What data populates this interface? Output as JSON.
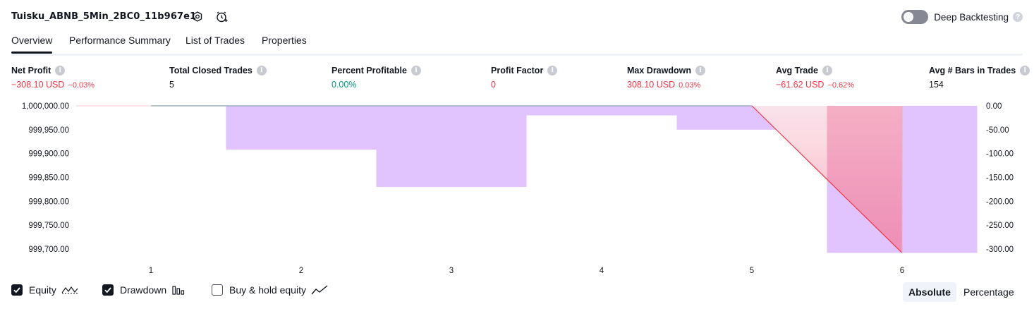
{
  "header": {
    "strategy_title": "Tuisku_ABNB_5Min_2BC0_11b967e1",
    "settings_icon": "gear-icon",
    "alert_icon": "alarm-clock-plus-icon",
    "deep_backtesting_label": "Deep Backtesting",
    "deep_backtesting_enabled": false,
    "help_glyph": "?"
  },
  "tabs": [
    {
      "label": "Overview",
      "active": true
    },
    {
      "label": "Performance Summary",
      "active": false
    },
    {
      "label": "List of Trades",
      "active": false
    },
    {
      "label": "Properties",
      "active": false
    }
  ],
  "metrics": [
    {
      "label": "Net Profit",
      "value": "−308.10 USD",
      "sub": "−0.03%",
      "tone": "neg"
    },
    {
      "label": "Total Closed Trades",
      "value": "5",
      "sub": "",
      "tone": "neutral"
    },
    {
      "label": "Percent Profitable",
      "value": "0.00%",
      "sub": "",
      "tone": "pos"
    },
    {
      "label": "Profit Factor",
      "value": "0",
      "sub": "",
      "tone": "neg"
    },
    {
      "label": "Max Drawdown",
      "value": "308.10 USD",
      "sub": "0.03%",
      "tone": "neg"
    },
    {
      "label": "Avg Trade",
      "value": "−61.62 USD",
      "sub": "−0.62%",
      "tone": "neg"
    },
    {
      "label": "Avg # Bars in Trades",
      "value": "154",
      "sub": "",
      "tone": "neutral"
    }
  ],
  "info_glyph": "i",
  "chart_data": {
    "type": "bar",
    "x_categories": [
      "1",
      "2",
      "3",
      "4",
      "5",
      "6"
    ],
    "left_axis": {
      "ticks": [
        "1,000,000.00",
        "999,950.00",
        "999,900.00",
        "999,850.00",
        "999,800.00",
        "999,750.00",
        "999,700.00"
      ],
      "range": [
        999700,
        1000000
      ]
    },
    "right_axis": {
      "ticks": [
        "0.00",
        "-50.00",
        "-100.00",
        "-150.00",
        "-200.00",
        "-250.00",
        "-300.00"
      ],
      "range": [
        -300,
        0
      ]
    },
    "series": [
      {
        "name": "Equity",
        "kind": "line",
        "values": [
          1000000,
          1000000,
          1000000,
          1000000,
          1000000,
          999691.9
        ],
        "color": "#f23645"
      },
      {
        "name": "Drawdown",
        "kind": "bar",
        "values": [
          0,
          -92,
          -170,
          -20,
          -50,
          -308.1
        ],
        "color": "#e1c3fd"
      }
    ],
    "equity_fill_color": "#f7a1b8",
    "legend": "bottom-left"
  },
  "bottom": {
    "legend_items": [
      {
        "label": "Equity",
        "checked": true,
        "icon": "equity-line-icon"
      },
      {
        "label": "Drawdown",
        "checked": true,
        "icon": "drawdown-bars-icon"
      },
      {
        "label": "Buy & hold equity",
        "checked": false,
        "icon": "buy-hold-line-icon"
      }
    ],
    "scale_buttons": [
      {
        "label": "Absolute",
        "active": true
      },
      {
        "label": "Percentage",
        "active": false
      }
    ]
  }
}
